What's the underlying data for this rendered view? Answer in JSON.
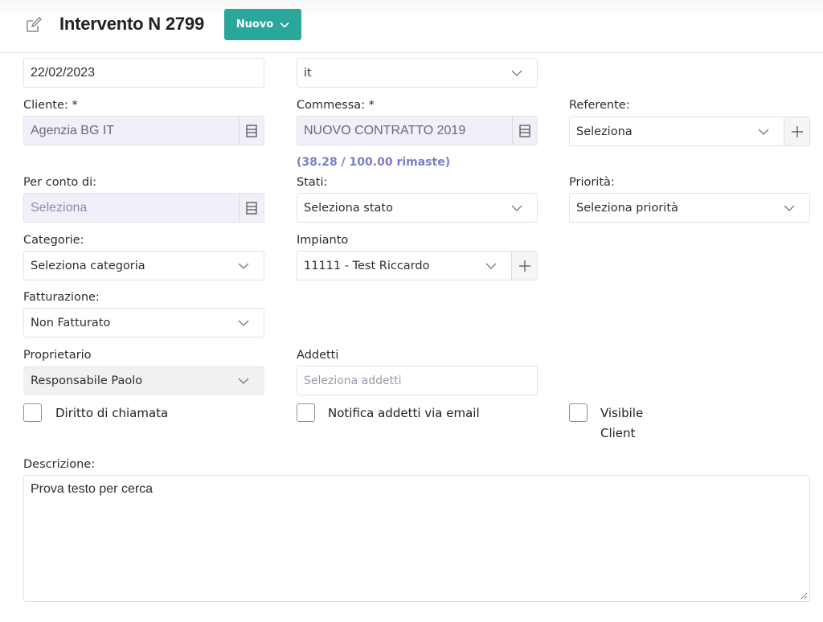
{
  "header": {
    "title": "Intervento N 2799",
    "new_button": "Nuovo"
  },
  "form": {
    "date_value": "22/02/2023",
    "language_value": "it",
    "cliente_label": "Cliente: *",
    "cliente_value": "Agenzia BG IT",
    "commessa_label": "Commessa: *",
    "commessa_value": "NUOVO CONTRATTO 2019",
    "commessa_remaining": "(38.28 / 100.00 rimaste)",
    "referente_label": "Referente:",
    "referente_value": "Seleziona",
    "per_conto_label": "Per conto di:",
    "per_conto_placeholder": "Seleziona",
    "stati_label": "Stati:",
    "stati_value": "Seleziona stato",
    "priorita_label": "Priorità:",
    "priorita_value": "Seleziona priorità",
    "categorie_label": "Categorie:",
    "categorie_value": "Seleziona categoria",
    "impianto_label": "Impianto",
    "impianto_value": "11111 - Test Riccardo",
    "fatturazione_label": "Fatturazione:",
    "fatturazione_value": "Non Fatturato",
    "proprietario_label": "Proprietario",
    "proprietario_value": "Responsabile Paolo",
    "addetti_label": "Addetti",
    "addetti_placeholder": "Seleziona addetti",
    "diritto_label": "Diritto di chiamata",
    "notifica_label": "Notifica addetti via email",
    "visibile_label_1": "Visibile",
    "visibile_label_2": "Client",
    "descrizione_label": "Descrizione:",
    "descrizione_value": "Prova testo per cerca"
  },
  "colors": {
    "accent": "#2aa69a",
    "remaining_text": "#7c7cc8",
    "disabled_bg": "#f0f0f8"
  }
}
